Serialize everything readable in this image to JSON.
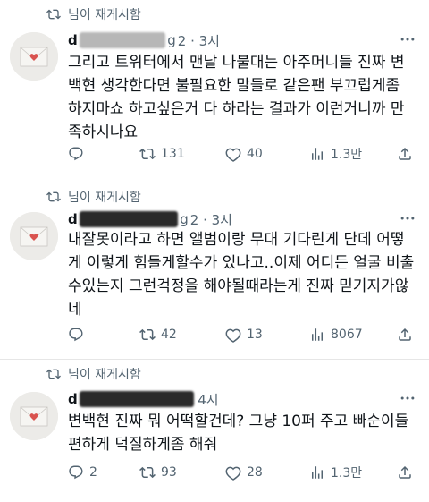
{
  "tweets": [
    {
      "retweet_label": "님이 재게시함",
      "handle": "d",
      "handle_suffix": "g",
      "time": "2 · 3시",
      "text": "그리고 트위터에서 맨날 나불대는 아주머니들 진짜 변\n백현 생각한다면 불필요한 말들로 같은팬 부끄럽게좀\n하지마쇼 하고싶은거 다 하라는 결과가 이런거니까 만\n족하시나요",
      "reply_count": "",
      "retweet_count": "131",
      "like_count": "40",
      "view_count": "1.3만"
    },
    {
      "retweet_label": "님이 재게시함",
      "handle": "d",
      "handle_suffix": "g",
      "time": "2 · 3시",
      "text": "내잘못이라고 하면 앨범이랑 무대 기다린게 단데 어떻\n게 이렇게 힘들게할수가 있나고..이제 어디든 얼굴 비출\n수있는지 그런걱정을 해야될때라는게 진짜 믿기지가않\n네",
      "reply_count": "",
      "retweet_count": "42",
      "like_count": "13",
      "view_count": "8067"
    },
    {
      "retweet_label": "님이 재게시함",
      "handle": "d",
      "handle_suffix": "",
      "time": "4시",
      "text": "변백현 진짜 뭐 어떡할건데? 그냥 10퍼 주고 빠순이들\n편하게 덕질하게좀 해줘",
      "reply_count": "2",
      "retweet_count": "93",
      "like_count": "28",
      "view_count": "1.3만"
    }
  ],
  "icons": [
    "retweet-icon",
    "more-icon",
    "reply-icon",
    "like-icon",
    "views-icon",
    "share-icon"
  ],
  "colors": {
    "text": "#0f1419",
    "secondary": "#536471",
    "avatar_bg": "#ecebe8",
    "heart": "#d9534f"
  }
}
